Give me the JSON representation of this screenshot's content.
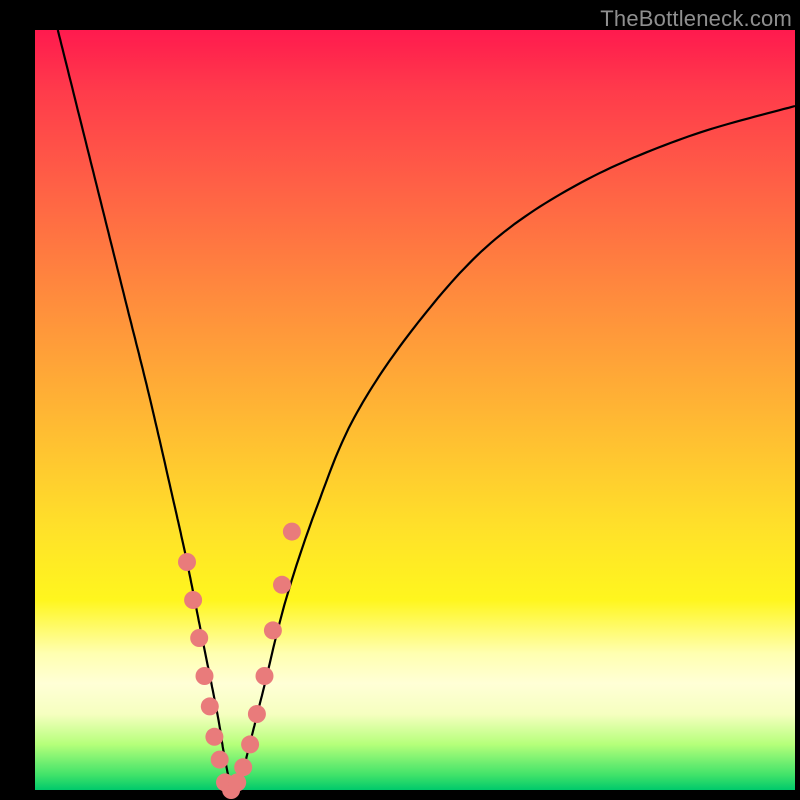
{
  "watermark": "TheBottleneck.com",
  "colors": {
    "curve": "#000000",
    "dot": "#e97b7b",
    "frame": "#000000"
  },
  "chart_data": {
    "type": "line",
    "title": "",
    "xlabel": "",
    "ylabel": "",
    "xlim": [
      0,
      100
    ],
    "ylim": [
      0,
      100
    ],
    "series": [
      {
        "name": "bottleneck-curve",
        "x": [
          3,
          6,
          9,
          12,
          15,
          18,
          20,
          22,
          24,
          25,
          26,
          27,
          28,
          30,
          33,
          37,
          42,
          50,
          60,
          72,
          86,
          100
        ],
        "y": [
          100,
          88,
          76,
          64,
          52,
          39,
          30,
          20,
          10,
          4,
          0,
          1,
          5,
          13,
          25,
          37,
          49,
          61,
          72,
          80,
          86,
          90
        ]
      }
    ],
    "scatter_points": {
      "name": "sampled-dots",
      "x": [
        20.0,
        20.8,
        21.6,
        22.3,
        23.0,
        23.6,
        24.3,
        25.0,
        25.8,
        26.6,
        27.4,
        28.3,
        29.2,
        30.2,
        31.3,
        32.5,
        33.8
      ],
      "y": [
        30,
        25,
        20,
        15,
        11,
        7,
        4,
        1,
        0,
        1,
        3,
        6,
        10,
        15,
        21,
        27,
        34
      ]
    }
  }
}
